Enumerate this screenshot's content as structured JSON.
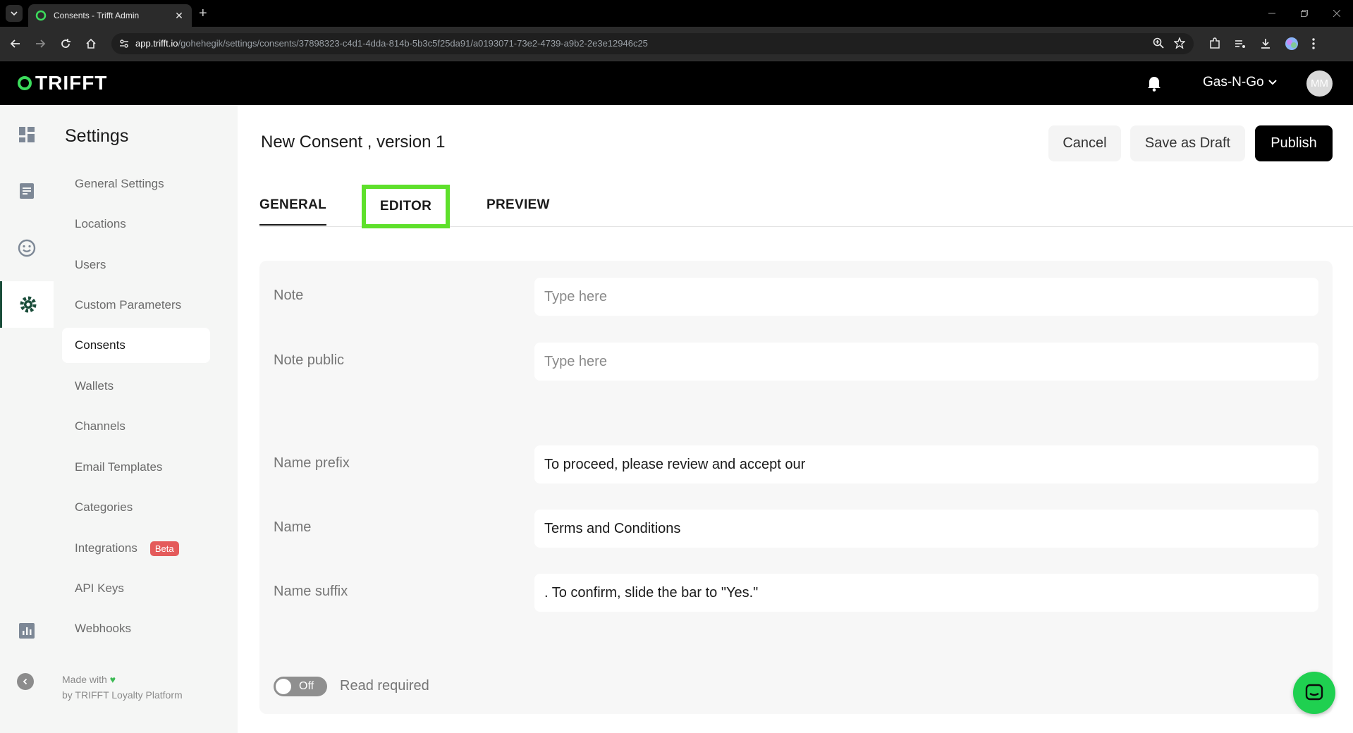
{
  "browser": {
    "tab_title": "Consents - Trifft Admin",
    "url_host": "app.trifft.io",
    "url_path": "/gohehegik/settings/consents/37898323-c4d1-4dda-814b-5b3c5f25da91/a0193071-73e2-4739-a9b2-2e3e12946c25"
  },
  "header": {
    "logo": "TRIFFT",
    "org_name": "Gas-N-Go",
    "avatar_initials": "MM"
  },
  "settings_nav": {
    "title": "Settings",
    "items": [
      {
        "label": "General Settings"
      },
      {
        "label": "Locations"
      },
      {
        "label": "Users"
      },
      {
        "label": "Custom Parameters"
      },
      {
        "label": "Consents"
      },
      {
        "label": "Wallets"
      },
      {
        "label": "Channels"
      },
      {
        "label": "Email Templates"
      },
      {
        "label": "Categories"
      },
      {
        "label": "Integrations",
        "badge": "Beta"
      },
      {
        "label": "API Keys"
      },
      {
        "label": "Webhooks"
      }
    ],
    "footer_line1": "Made with",
    "footer_line2": "by TRIFFT Loyalty Platform"
  },
  "page": {
    "title": "New Consent , version 1",
    "cancel_label": "Cancel",
    "draft_label": "Save as Draft",
    "publish_label": "Publish"
  },
  "tabs": {
    "general": "GENERAL",
    "editor": "EDITOR",
    "preview": "PREVIEW"
  },
  "form": {
    "note_label": "Note",
    "note_placeholder": "Type here",
    "note_public_label": "Note public",
    "note_public_placeholder": "Type here",
    "name_prefix_label": "Name prefix",
    "name_prefix_value": "To proceed, please review and accept our",
    "name_label": "Name",
    "name_value": "Terms and Conditions",
    "name_suffix_label": "Name suffix",
    "name_suffix_value": ". To confirm, slide the bar to \"Yes.\"",
    "toggle_state": "Off",
    "toggle_label": "Read required"
  },
  "colors": {
    "accent_green": "#1fd050",
    "highlight_green": "#5ee02b",
    "badge_red": "#e45b5b"
  }
}
